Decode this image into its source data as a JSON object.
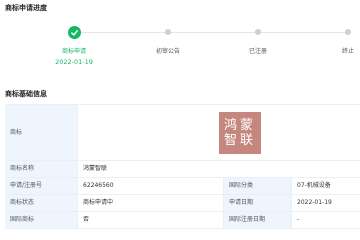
{
  "progress": {
    "title": "商标申请进度",
    "steps": [
      {
        "label": "商标申请",
        "date": "2022-01-19",
        "done": true
      },
      {
        "label": "初审公告",
        "done": false
      },
      {
        "label": "已注册",
        "done": false
      },
      {
        "label": "终止",
        "done": false
      }
    ],
    "colors": {
      "done": "#18b566",
      "pending": "#cfcfcf"
    }
  },
  "basic_info": {
    "title": "商标基础信息",
    "logo_label": "商标",
    "logo_text": [
      "鸿蒙",
      "智联"
    ],
    "logo_color": "#c5867d",
    "rows": [
      {
        "label": "商标名称",
        "value": "鸿蒙智联"
      },
      {
        "label": "申请/注册号",
        "value": "62246560",
        "label2": "国际分类",
        "value2": "07-机械设备"
      },
      {
        "label": "商标状态",
        "value": "商标申请中",
        "label2": "申请日期",
        "value2": "2022-01-19"
      },
      {
        "label": "国际商标",
        "value": "否",
        "label2": "国际注册日期",
        "value2": "-"
      }
    ]
  }
}
